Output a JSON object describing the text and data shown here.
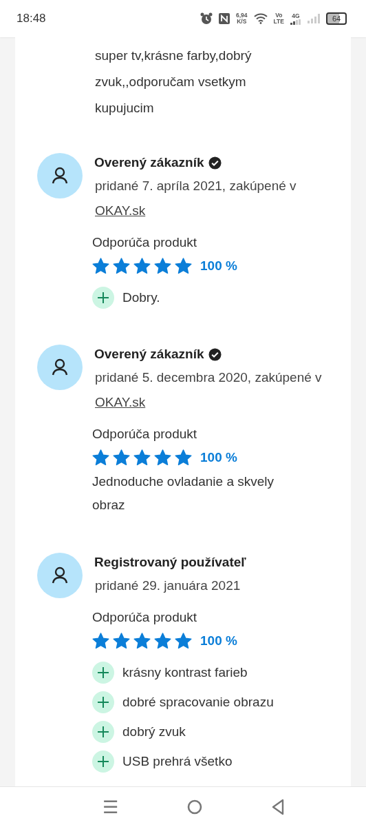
{
  "status_bar": {
    "time": "18:48",
    "speed": "6,94",
    "speed_unit": "K/S",
    "volte_top": "Vo",
    "volte_bottom": "LTE",
    "network": "4G",
    "battery": "64"
  },
  "reviews": [
    {
      "comment": "super tv,krásne farby,dobrý zvuk,,odporučam vsetkym kupujucim"
    },
    {
      "author": "Overený zákazník",
      "verified": true,
      "meta": "pridané 7. apríla 2021, zakúpené v",
      "shop": "OKAY.sk",
      "recommend_label": "Odporúča produkt",
      "stars": 5,
      "percent": "100 %",
      "pros": [
        "Dobry."
      ]
    },
    {
      "author": "Overený zákazník",
      "verified": true,
      "meta": "pridané 5. decembra 2020, zakúpené v",
      "shop": "OKAY.sk",
      "recommend_label": "Odporúča produkt",
      "stars": 5,
      "percent": "100 %",
      "comment": "Jednoduche ovladanie a skvely obraz"
    },
    {
      "author": "Registrovaný používateľ",
      "verified": false,
      "meta": "pridané 29. januára 2021",
      "recommend_label": "Odporúča produkt",
      "stars": 5,
      "percent": "100 %",
      "pros": [
        "krásny kontrast farieb",
        "dobré spracovanie obrazu",
        "dobrý zvuk",
        "USB prehrá všetko"
      ]
    }
  ],
  "nav_bar": {
    "recents": "☰"
  }
}
